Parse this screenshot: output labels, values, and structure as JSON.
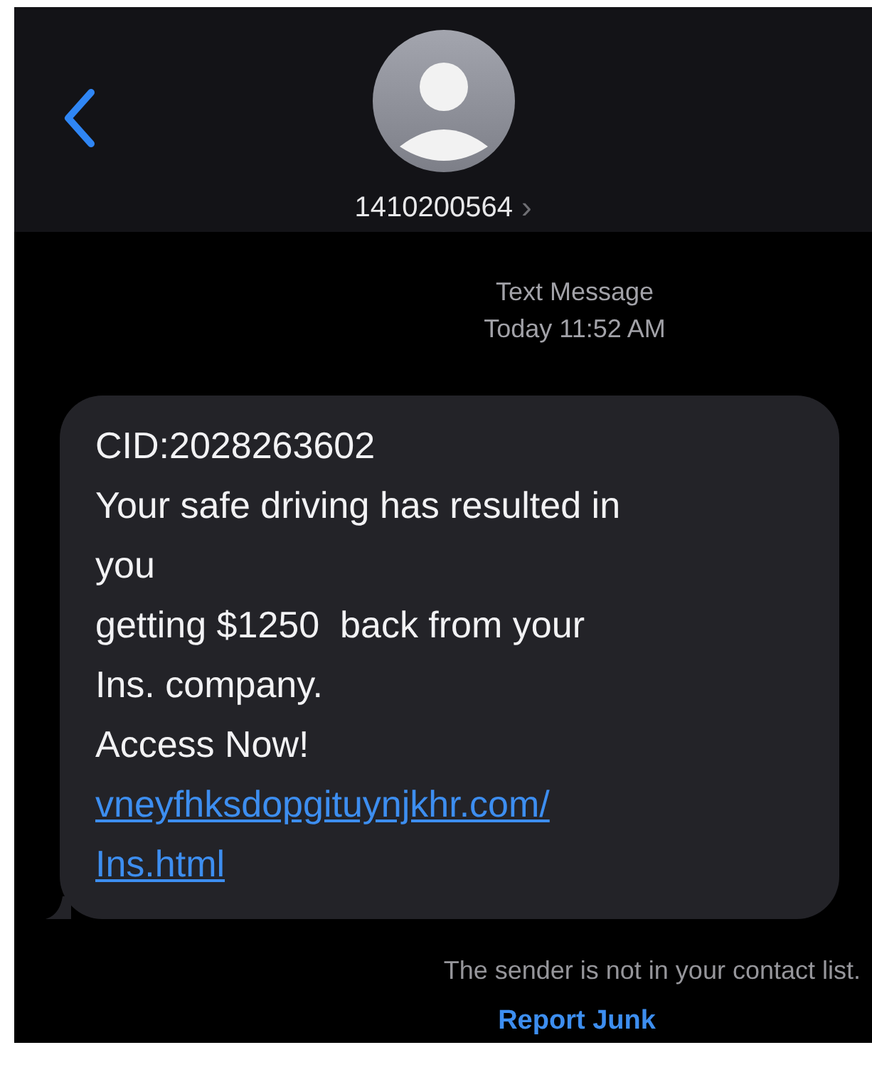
{
  "header": {
    "contact": "1410200564",
    "chevron": "›"
  },
  "timestamp": {
    "service": "Text Message",
    "time": "Today 11:52 AM"
  },
  "message": {
    "lines": [
      "CID:2028263602",
      "Your safe driving has resulted in",
      "you",
      "getting $1250  back from your",
      "Ins. company.",
      "Access Now!"
    ],
    "link_lines": [
      "vneyfhksdopgituynjkhr.com/",
      "Ins.html"
    ]
  },
  "notice": "The sender is not in your contact list.",
  "report_button": "Report Junk"
}
